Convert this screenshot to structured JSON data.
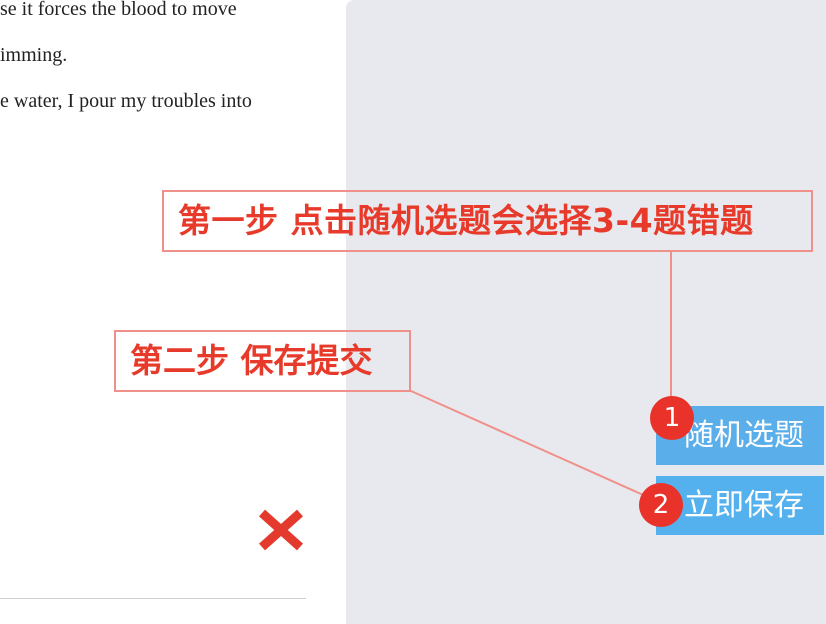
{
  "passage": {
    "lines": [
      "se it forces the blood to move",
      "imming.",
      "e water, I pour my troubles into"
    ]
  },
  "result_icon": "red-x-icon",
  "buttons": {
    "random_label": "随机选题",
    "save_label": "立即保存"
  },
  "annotations": {
    "step1_text": "第一步 点击随机选题会选择3-4题错题",
    "step2_text": "第二步 保存提交",
    "badge1": "1",
    "badge2": "2"
  },
  "colors": {
    "button_blue": "#5aaeea",
    "annotation_red": "#e83a2a",
    "callout_border": "#f0908a",
    "panel_gray": "#e8e9ee"
  }
}
